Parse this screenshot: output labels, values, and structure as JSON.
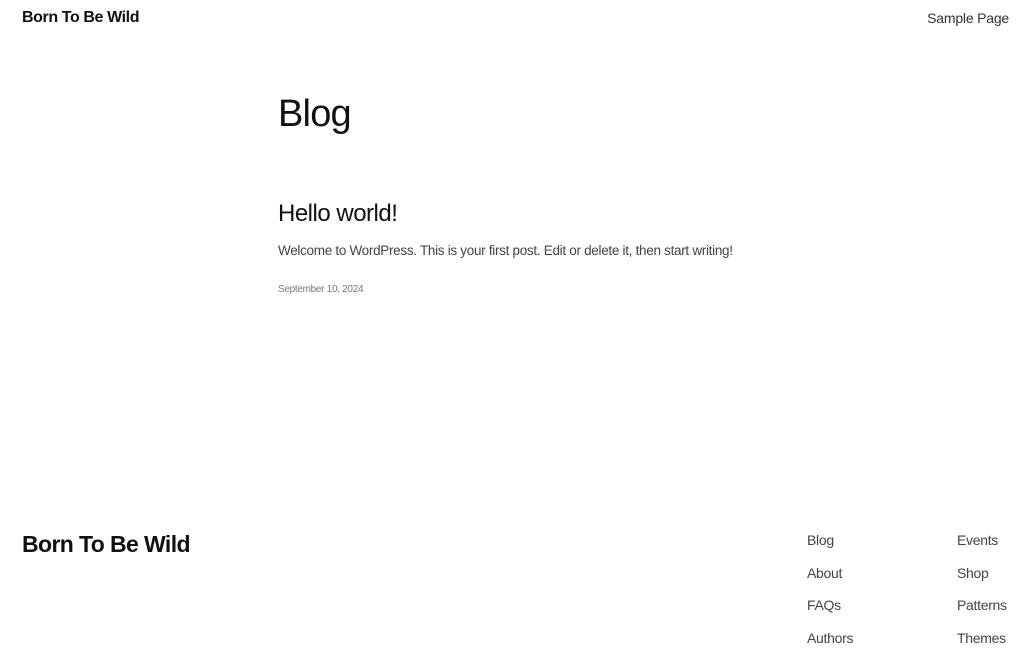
{
  "header": {
    "site_title": "Born To Be Wild",
    "nav": [
      {
        "label": "Sample Page"
      }
    ]
  },
  "main": {
    "page_title": "Blog",
    "posts": [
      {
        "title": "Hello world!",
        "excerpt": "Welcome to WordPress. This is your first post. Edit or delete it, then start writing!",
        "date": "September 10, 2024"
      }
    ]
  },
  "footer": {
    "site_title": "Born To Be Wild",
    "columns": [
      {
        "links": [
          {
            "label": "Blog"
          },
          {
            "label": "About"
          },
          {
            "label": "FAQs"
          },
          {
            "label": "Authors"
          }
        ]
      },
      {
        "links": [
          {
            "label": "Events"
          },
          {
            "label": "Shop"
          },
          {
            "label": "Patterns"
          },
          {
            "label": "Themes"
          }
        ]
      }
    ]
  }
}
